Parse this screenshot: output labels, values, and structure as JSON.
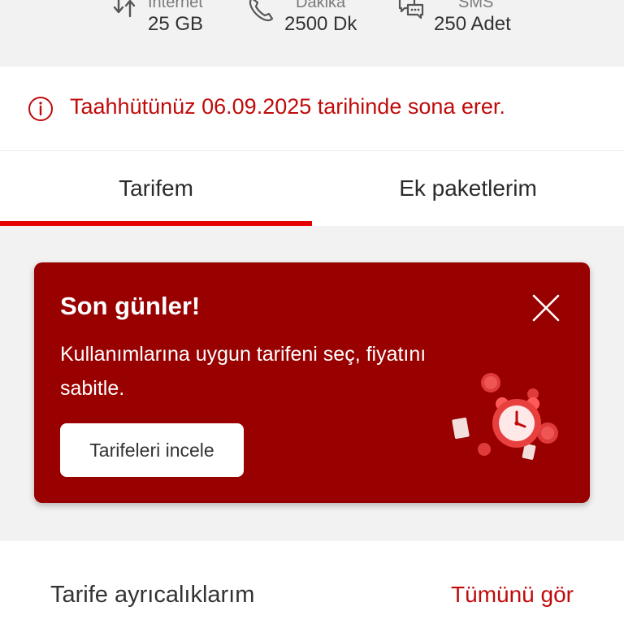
{
  "allowances": [
    {
      "label": "İnternet",
      "value": "25 GB",
      "icon": "data-transfer-icon"
    },
    {
      "label": "Dakika",
      "value": "2500 Dk",
      "icon": "phone-icon"
    },
    {
      "label": "SMS",
      "value": "250 Adet",
      "icon": "chat-bubbles-icon"
    }
  ],
  "notice": {
    "text": "Taahhütünüz 06.09.2025 tarihinde sona erer.",
    "icon": "info-icon",
    "color": "#c00b0b"
  },
  "tabs": [
    {
      "label": "Tarifem",
      "active": true
    },
    {
      "label": "Ek paketlerim",
      "active": false
    }
  ],
  "promo": {
    "title": "Son günler!",
    "body": "Kullanımlarına uygun tarifeni seç, fiyatını sabitle.",
    "button_label": "Tarifeleri incele",
    "background": "#990000",
    "close_icon": "close-icon",
    "illustration": "alarm-clock-illustration"
  },
  "privileges": {
    "title": "Tarife ayrıcalıklarım",
    "link_label": "Tümünü gör"
  },
  "colors": {
    "accent": "#e60000",
    "text_red": "#c00b0b"
  }
}
